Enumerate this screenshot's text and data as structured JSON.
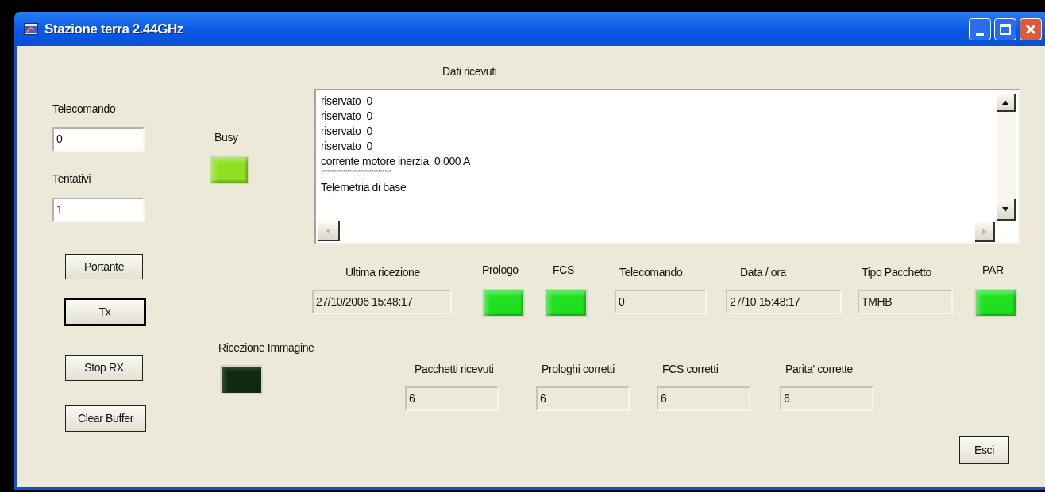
{
  "window": {
    "title": "Stazione terra 2.44GHz"
  },
  "left_fields": [
    {
      "label": "Telecomando",
      "value": "0"
    },
    {
      "label": "Tentativi",
      "value": "1"
    }
  ],
  "busy": {
    "label": "Busy",
    "on": true,
    "color": "#8ee020"
  },
  "buttons": [
    {
      "label": "Portante",
      "default": false
    },
    {
      "label": "Tx",
      "default": true
    },
    {
      "label": "Stop RX",
      "default": false
    },
    {
      "label": "Clear Buffer",
      "default": false
    }
  ],
  "received": {
    "label": "Dati ricevuti",
    "lines": [
      "riservato  0",
      "riservato  0",
      "riservato  0",
      "riservato  0",
      "corrente motore inerzia  0.000 A",
      "********************************",
      "Telemetria di base"
    ]
  },
  "status_row": [
    {
      "kind": "field",
      "label": "Ultima ricezione",
      "value": "27/10/2006 15:48:17"
    },
    {
      "kind": "led",
      "label": "Prologo",
      "on": true,
      "color": "#1ee01e"
    },
    {
      "kind": "led",
      "label": "FCS",
      "on": true,
      "color": "#1ee01e"
    },
    {
      "kind": "field",
      "label": "Telecomando",
      "value": "0"
    },
    {
      "kind": "field",
      "label": "Data / ora",
      "value": "27/10 15:48:17"
    },
    {
      "kind": "field",
      "label": "Tipo Pacchetto",
      "value": "TMHB"
    },
    {
      "kind": "led",
      "label": "PAR",
      "on": true,
      "color": "#1ee01e"
    }
  ],
  "image_rx": {
    "label": "Ricezione Immagine",
    "on": false
  },
  "counters": [
    {
      "label": "Pacchetti ricevuti",
      "value": "6"
    },
    {
      "label": "Prologhi corretti",
      "value": "6"
    },
    {
      "label": "FCS corretti",
      "value": "6"
    },
    {
      "label": "Parita' corrette",
      "value": "6"
    }
  ],
  "exit_button": {
    "label": "Esci"
  }
}
